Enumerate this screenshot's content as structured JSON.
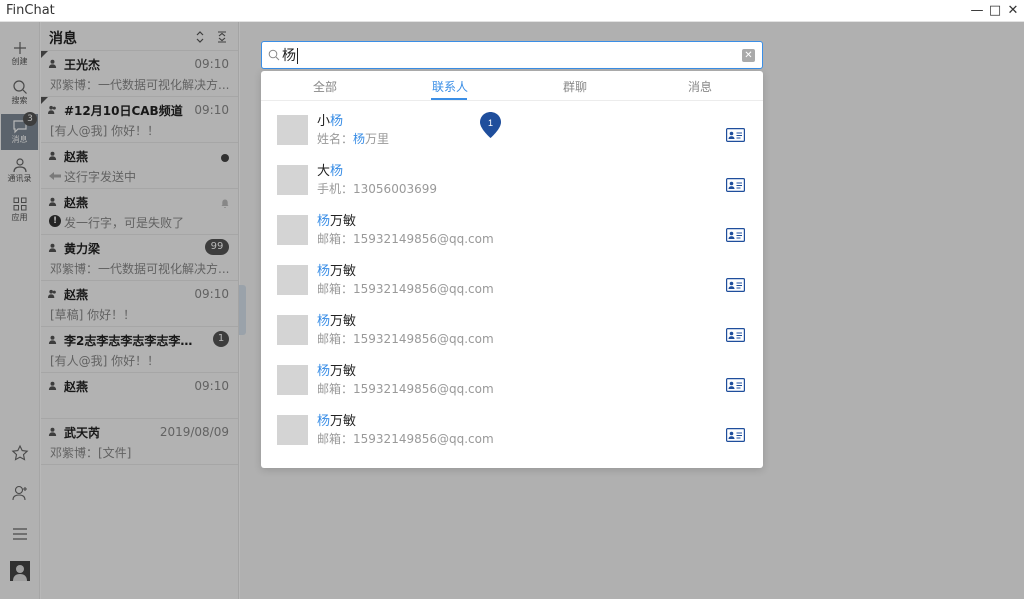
{
  "app": {
    "title": "FinChat"
  },
  "window": {
    "minimize": "—",
    "maximize": "□",
    "close": "✕"
  },
  "rail": {
    "items": [
      {
        "label": "创建",
        "icon": "plus-icon"
      },
      {
        "label": "搜索",
        "icon": "search-icon"
      },
      {
        "label": "消息",
        "icon": "chat-icon",
        "badge": "3"
      },
      {
        "label": "通讯录",
        "icon": "contacts-icon"
      },
      {
        "label": "应用",
        "icon": "apps-icon"
      }
    ],
    "bottom": [
      "star-icon",
      "user-add-icon",
      "menu-icon",
      "avatar"
    ]
  },
  "list": {
    "title": "消息",
    "conversations": [
      {
        "name": "王光杰",
        "time": "09:10",
        "preview": "邓紫博：一代数据可视化解决方..."
      },
      {
        "name": "#12月10日CAB频道",
        "time": "09:10",
        "preview": "[有人@我] 你好！！"
      },
      {
        "name": "赵燕",
        "preview": "这行字发送中"
      },
      {
        "name": "赵燕",
        "preview": "发一行字，可是失败了"
      },
      {
        "name": "黄力梁",
        "badge": "99",
        "preview": "邓紫博：一代数据可视化解决方..."
      },
      {
        "name": "赵燕",
        "time": "09:10",
        "preview": "[草稿] 你好！！"
      },
      {
        "name": "李2志李志李志李志李志...",
        "badge": "1",
        "preview": "[有人@我] 你好！！"
      },
      {
        "name": "赵燕",
        "time": "09:10",
        "preview": ""
      },
      {
        "name": "武天芮",
        "time": "2019/08/09",
        "preview": "邓紫博：[文件]"
      }
    ]
  },
  "search": {
    "value": "杨"
  },
  "tabs": [
    "全部",
    "联系人",
    "群聊",
    "消息"
  ],
  "results": [
    {
      "prefix": "小",
      "match": "杨",
      "suffix": "",
      "sub_label": "姓名：",
      "sub_match": "杨",
      "sub_rest": "万里"
    },
    {
      "prefix": "大",
      "match": "杨",
      "suffix": "",
      "sub_label": "手机：",
      "sub_match": "",
      "sub_rest": "13056003699"
    },
    {
      "prefix": "",
      "match": "杨",
      "suffix": "万敏",
      "sub_label": "邮箱：",
      "sub_match": "",
      "sub_rest": "15932149856@qq.com"
    },
    {
      "prefix": "",
      "match": "杨",
      "suffix": "万敏",
      "sub_label": "邮箱：",
      "sub_match": "",
      "sub_rest": "15932149856@qq.com"
    },
    {
      "prefix": "",
      "match": "杨",
      "suffix": "万敏",
      "sub_label": "邮箱：",
      "sub_match": "",
      "sub_rest": "15932149856@qq.com"
    },
    {
      "prefix": "",
      "match": "杨",
      "suffix": "万敏",
      "sub_label": "邮箱：",
      "sub_match": "",
      "sub_rest": "15932149856@qq.com"
    },
    {
      "prefix": "",
      "match": "杨",
      "suffix": "万敏",
      "sub_label": "邮箱：",
      "sub_match": "",
      "sub_rest": "15932149856@qq.com"
    }
  ],
  "pin": {
    "label": "1"
  },
  "colors": {
    "accent": "#3a8ee6",
    "card_icon": "#1f4e9c"
  }
}
